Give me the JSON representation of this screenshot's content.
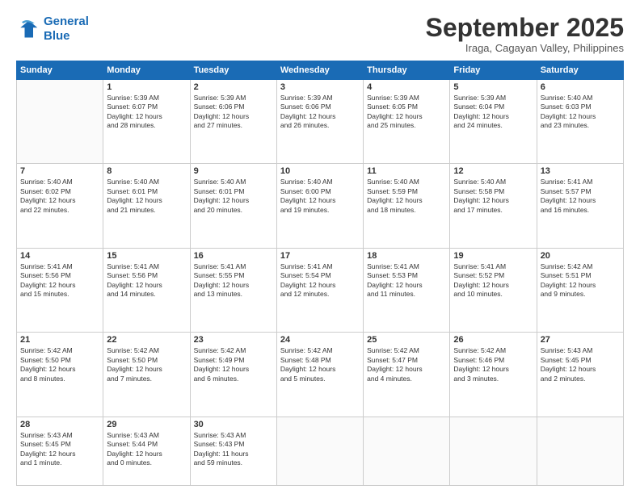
{
  "logo": {
    "line1": "General",
    "line2": "Blue"
  },
  "title": "September 2025",
  "location": "Iraga, Cagayan Valley, Philippines",
  "days_header": [
    "Sunday",
    "Monday",
    "Tuesday",
    "Wednesday",
    "Thursday",
    "Friday",
    "Saturday"
  ],
  "weeks": [
    [
      {
        "num": "",
        "info": ""
      },
      {
        "num": "1",
        "info": "Sunrise: 5:39 AM\nSunset: 6:07 PM\nDaylight: 12 hours\nand 28 minutes."
      },
      {
        "num": "2",
        "info": "Sunrise: 5:39 AM\nSunset: 6:06 PM\nDaylight: 12 hours\nand 27 minutes."
      },
      {
        "num": "3",
        "info": "Sunrise: 5:39 AM\nSunset: 6:06 PM\nDaylight: 12 hours\nand 26 minutes."
      },
      {
        "num": "4",
        "info": "Sunrise: 5:39 AM\nSunset: 6:05 PM\nDaylight: 12 hours\nand 25 minutes."
      },
      {
        "num": "5",
        "info": "Sunrise: 5:39 AM\nSunset: 6:04 PM\nDaylight: 12 hours\nand 24 minutes."
      },
      {
        "num": "6",
        "info": "Sunrise: 5:40 AM\nSunset: 6:03 PM\nDaylight: 12 hours\nand 23 minutes."
      }
    ],
    [
      {
        "num": "7",
        "info": "Sunrise: 5:40 AM\nSunset: 6:02 PM\nDaylight: 12 hours\nand 22 minutes."
      },
      {
        "num": "8",
        "info": "Sunrise: 5:40 AM\nSunset: 6:01 PM\nDaylight: 12 hours\nand 21 minutes."
      },
      {
        "num": "9",
        "info": "Sunrise: 5:40 AM\nSunset: 6:01 PM\nDaylight: 12 hours\nand 20 minutes."
      },
      {
        "num": "10",
        "info": "Sunrise: 5:40 AM\nSunset: 6:00 PM\nDaylight: 12 hours\nand 19 minutes."
      },
      {
        "num": "11",
        "info": "Sunrise: 5:40 AM\nSunset: 5:59 PM\nDaylight: 12 hours\nand 18 minutes."
      },
      {
        "num": "12",
        "info": "Sunrise: 5:40 AM\nSunset: 5:58 PM\nDaylight: 12 hours\nand 17 minutes."
      },
      {
        "num": "13",
        "info": "Sunrise: 5:41 AM\nSunset: 5:57 PM\nDaylight: 12 hours\nand 16 minutes."
      }
    ],
    [
      {
        "num": "14",
        "info": "Sunrise: 5:41 AM\nSunset: 5:56 PM\nDaylight: 12 hours\nand 15 minutes."
      },
      {
        "num": "15",
        "info": "Sunrise: 5:41 AM\nSunset: 5:56 PM\nDaylight: 12 hours\nand 14 minutes."
      },
      {
        "num": "16",
        "info": "Sunrise: 5:41 AM\nSunset: 5:55 PM\nDaylight: 12 hours\nand 13 minutes."
      },
      {
        "num": "17",
        "info": "Sunrise: 5:41 AM\nSunset: 5:54 PM\nDaylight: 12 hours\nand 12 minutes."
      },
      {
        "num": "18",
        "info": "Sunrise: 5:41 AM\nSunset: 5:53 PM\nDaylight: 12 hours\nand 11 minutes."
      },
      {
        "num": "19",
        "info": "Sunrise: 5:41 AM\nSunset: 5:52 PM\nDaylight: 12 hours\nand 10 minutes."
      },
      {
        "num": "20",
        "info": "Sunrise: 5:42 AM\nSunset: 5:51 PM\nDaylight: 12 hours\nand 9 minutes."
      }
    ],
    [
      {
        "num": "21",
        "info": "Sunrise: 5:42 AM\nSunset: 5:50 PM\nDaylight: 12 hours\nand 8 minutes."
      },
      {
        "num": "22",
        "info": "Sunrise: 5:42 AM\nSunset: 5:50 PM\nDaylight: 12 hours\nand 7 minutes."
      },
      {
        "num": "23",
        "info": "Sunrise: 5:42 AM\nSunset: 5:49 PM\nDaylight: 12 hours\nand 6 minutes."
      },
      {
        "num": "24",
        "info": "Sunrise: 5:42 AM\nSunset: 5:48 PM\nDaylight: 12 hours\nand 5 minutes."
      },
      {
        "num": "25",
        "info": "Sunrise: 5:42 AM\nSunset: 5:47 PM\nDaylight: 12 hours\nand 4 minutes."
      },
      {
        "num": "26",
        "info": "Sunrise: 5:42 AM\nSunset: 5:46 PM\nDaylight: 12 hours\nand 3 minutes."
      },
      {
        "num": "27",
        "info": "Sunrise: 5:43 AM\nSunset: 5:45 PM\nDaylight: 12 hours\nand 2 minutes."
      }
    ],
    [
      {
        "num": "28",
        "info": "Sunrise: 5:43 AM\nSunset: 5:45 PM\nDaylight: 12 hours\nand 1 minute."
      },
      {
        "num": "29",
        "info": "Sunrise: 5:43 AM\nSunset: 5:44 PM\nDaylight: 12 hours\nand 0 minutes."
      },
      {
        "num": "30",
        "info": "Sunrise: 5:43 AM\nSunset: 5:43 PM\nDaylight: 11 hours\nand 59 minutes."
      },
      {
        "num": "",
        "info": ""
      },
      {
        "num": "",
        "info": ""
      },
      {
        "num": "",
        "info": ""
      },
      {
        "num": "",
        "info": ""
      }
    ]
  ]
}
